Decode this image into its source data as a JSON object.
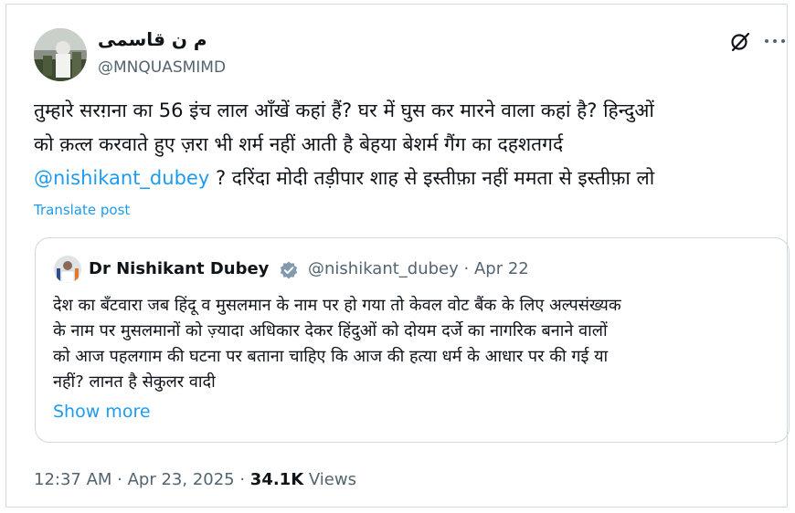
{
  "author": {
    "display_name": "م ن قاسمی",
    "handle": "@MNQUASMIMD",
    "avatar_icon": "profile-photo"
  },
  "tweet": {
    "lines": [
      "तुम्हारे सरग़ना का 56 इंच लाल आँखें कहां हैं? घर में घुस कर मारने वाला कहां है? हिन्दुओं",
      "को क़त्ल करवाते हुए ज़रा भी शर्म नहीं आती है बेहया बेशर्म गैंग का दहशतगर्द"
    ],
    "mention": "@nishikant_dubey",
    "last_line_rest": " ? दरिंदा मोदी तड़ीपार शाह से इस्तीफ़ा नहीं ममता से इस्तीफ़ा लो",
    "translate_label": "Translate post"
  },
  "quote": {
    "name": "Dr Nishikant Dubey",
    "meta": "@nishikant_dubey · Apr 22",
    "verified_icon": "verified-badge-icon",
    "lines": [
      "देश का बँटवारा जब हिंदू व मुसलमान के नाम पर हो गया तो केवल वोट बैंक के लिए अल्पसंख्यक",
      "के नाम पर मुसलमानों को ज़्यादा अधिकार देकर हिंदुओं को दोयम दर्जे का नागरिक बनाने वालों",
      "को आज पहलगाम की घटना पर बताना चाहिए कि आज की हत्या धर्म के आधार पर की गई या",
      "नहीं? लानत है सेकुलर वादी"
    ],
    "show_more": "Show more"
  },
  "footer": {
    "timestamp": "12:37 AM · Apr 23, 2025 · ",
    "views_count": "34.1K",
    "views_label": " Views"
  },
  "colors": {
    "accent": "#1d9bf0",
    "secondary_text": "#536471",
    "primary_text": "#0f1419",
    "border": "#cfd9de"
  }
}
